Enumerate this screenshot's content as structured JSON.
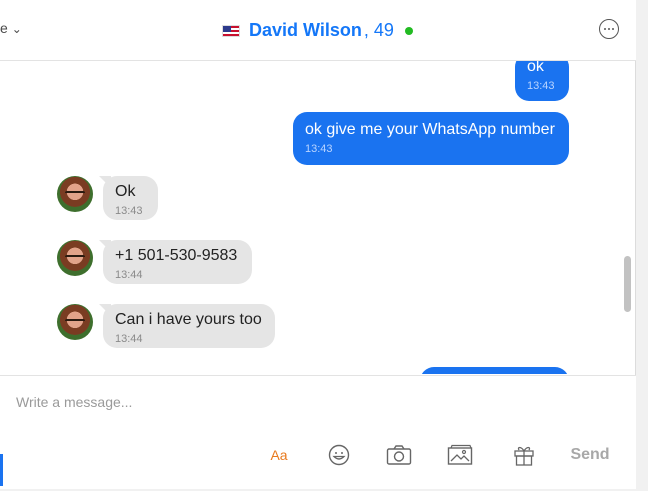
{
  "header": {
    "prev_fragment": "e",
    "contact_name": "David Wilson",
    "contact_age": ", 49",
    "status_color": "#22bb22",
    "flag_icon": "us-flag-icon",
    "more_icon": "more-options-icon"
  },
  "messages": [
    {
      "direction": "out",
      "text": "ok",
      "time": "13:43"
    },
    {
      "direction": "out",
      "text": "ok give me your WhatsApp number",
      "time": "13:43"
    },
    {
      "direction": "in",
      "text": "Ok",
      "time": "13:43"
    },
    {
      "direction": "in",
      "text": "+1 501-530-9583",
      "time": "13:44"
    },
    {
      "direction": "in",
      "text": "Can i have yours too",
      "time": "13:44"
    }
  ],
  "composer": {
    "placeholder": "Write a message...",
    "value": "",
    "format_label": "Aa",
    "send_label": "Send",
    "tools": [
      "text-format-icon",
      "emoji-icon",
      "camera-icon",
      "image-gallery-icon",
      "gift-icon"
    ]
  },
  "colors": {
    "accent": "#1477f8",
    "outgoing_bubble": "#1a73f0",
    "incoming_bubble": "#e5e5e5",
    "format_icon": "#e87a1e"
  }
}
